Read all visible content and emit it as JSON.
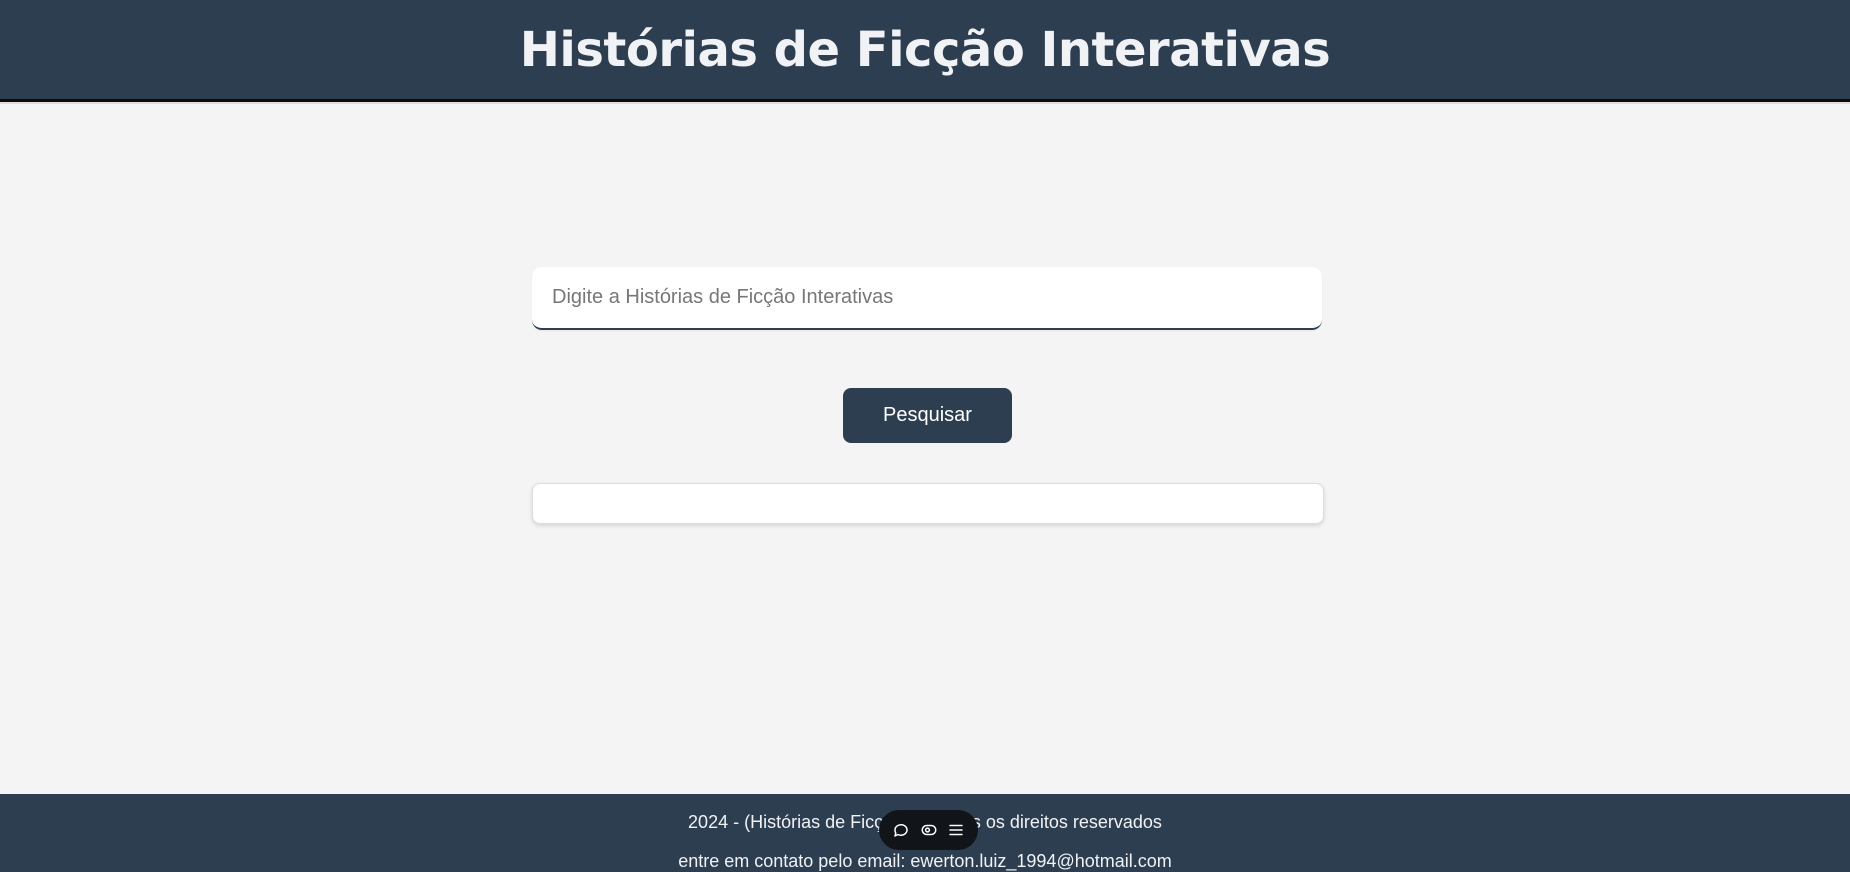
{
  "header": {
    "title": "Histórias de Ficção Interativas"
  },
  "search": {
    "placeholder": "Digite a Histórias de Ficção Interativas",
    "value": "",
    "button_label": "Pesquisar"
  },
  "results": {
    "items": []
  },
  "footer": {
    "copyright": "2024 - (Histórias de Ficção I... Todos os direitos reservados",
    "contact": "entre em contato pelo email: ewerton.luiz_1994@hotmail.com"
  },
  "toolbar": {
    "icons": [
      "chat-bubble-icon",
      "eye-icon",
      "menu-icon"
    ]
  },
  "colors": {
    "header_bg": "#2d3e50",
    "page_bg": "#f4f4f4",
    "button_bg": "#2d3e50",
    "toolbar_bg": "#111418"
  }
}
